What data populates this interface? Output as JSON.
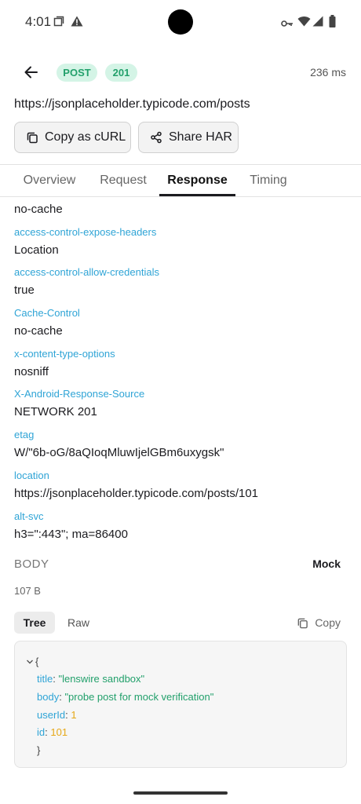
{
  "status_bar": {
    "time": "4:01"
  },
  "header": {
    "method": "POST",
    "status_code": "201",
    "duration": "236 ms"
  },
  "request": {
    "url": "https://jsonplaceholder.typicode.com/posts"
  },
  "actions": {
    "copy_curl": "Copy as cURL",
    "share_har": "Share HAR"
  },
  "tabs": [
    {
      "label": "Overview"
    },
    {
      "label": "Request"
    },
    {
      "label": "Response"
    },
    {
      "label": "Timing"
    }
  ],
  "active_tab": "Response",
  "response_headers": [
    {
      "name": "",
      "value": "no-cache"
    },
    {
      "name": "access-control-expose-headers",
      "value": "Location"
    },
    {
      "name": "access-control-allow-credentials",
      "value": "true"
    },
    {
      "name": "Cache-Control",
      "value": "no-cache"
    },
    {
      "name": "x-content-type-options",
      "value": "nosniff"
    },
    {
      "name": "X-Android-Response-Source",
      "value": "NETWORK 201"
    },
    {
      "name": "etag",
      "value": "W/\"6b-oG/8aQIoqMluwIjelGBm6uxygsk\""
    },
    {
      "name": "location",
      "value": "https://jsonplaceholder.typicode.com/posts/101"
    },
    {
      "name": "alt-svc",
      "value": "h3=\":443\"; ma=86400"
    }
  ],
  "body": {
    "label": "BODY",
    "mock_label": "Mock",
    "size": "107 B",
    "view_tree": "Tree",
    "view_raw": "Raw",
    "copy_label": "Copy",
    "json": {
      "open_brace": "{",
      "close_brace": "}",
      "fields": [
        {
          "key": "title",
          "value": "\"lenswire sandbox\"",
          "type": "string"
        },
        {
          "key": "body",
          "value": "\"probe post for mock verification\"",
          "type": "string"
        },
        {
          "key": "userId",
          "value": "1",
          "type": "number"
        },
        {
          "key": "id",
          "value": "101",
          "type": "number"
        }
      ]
    }
  },
  "colors": {
    "accent_green": "#22a06b",
    "chip_background": "#d4f4e6",
    "header_key_blue": "#2fa4d6",
    "number_yellow": "#e6a817"
  }
}
